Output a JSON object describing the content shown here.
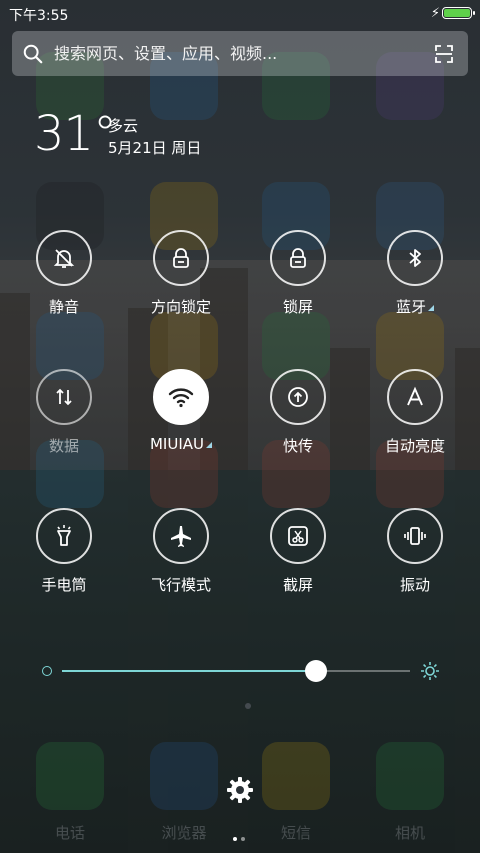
{
  "status_bar": {
    "time": "下午3:55",
    "battery_level": 1.0,
    "battery_color": "#5fd14b"
  },
  "search": {
    "placeholder": "搜索网页、设置、应用、视频..."
  },
  "weather": {
    "temperature": "31°",
    "condition": "多云",
    "date": "5月21日 周日"
  },
  "toggles": [
    {
      "label": "静音",
      "icon": "bell-off-icon",
      "active": false
    },
    {
      "label": "方向锁定",
      "icon": "orientation-lock-icon",
      "active": false
    },
    {
      "label": "锁屏",
      "icon": "lock-screen-icon",
      "active": false
    },
    {
      "label": "蓝牙",
      "icon": "bluetooth-icon",
      "active": false,
      "has_more": true
    },
    {
      "label": "数据",
      "icon": "data-arrows-icon",
      "active": false,
      "dimmed": true
    },
    {
      "label": "MIUIAU",
      "icon": "wifi-icon",
      "active": true,
      "has_more": true
    },
    {
      "label": "快传",
      "icon": "quick-transfer-icon",
      "active": false
    },
    {
      "label": "自动亮度",
      "icon": "auto-brightness-icon",
      "active": false
    },
    {
      "label": "手电筒",
      "icon": "flashlight-icon",
      "active": false
    },
    {
      "label": "飞行模式",
      "icon": "airplane-icon",
      "active": false
    },
    {
      "label": "截屏",
      "icon": "screenshot-icon",
      "active": false
    },
    {
      "label": "振动",
      "icon": "vibrate-icon",
      "active": false
    }
  ],
  "brightness": {
    "level": 0.73,
    "accent": "#7ed6d6"
  },
  "background_dock_labels": [
    "电话",
    "浏览器",
    "短信",
    "相机"
  ],
  "pager": {
    "pages": 2,
    "current": 0
  }
}
